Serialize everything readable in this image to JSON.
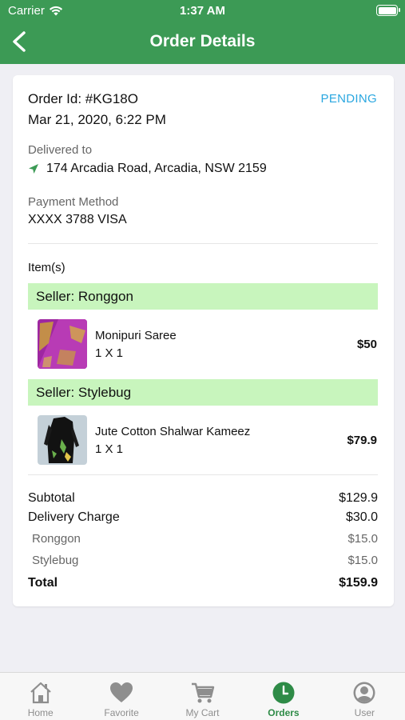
{
  "status_bar": {
    "carrier": "Carrier",
    "time": "1:37 AM"
  },
  "header": {
    "title": "Order Details"
  },
  "order": {
    "id_label": "Order Id: #KG18O",
    "date": "Mar 21, 2020, 6:22 PM",
    "status": "PENDING",
    "delivered_to_label": "Delivered to",
    "address": "174 Arcadia Road, Arcadia, NSW 2159",
    "payment_label": "Payment Method",
    "payment_value": "XXXX 3788 VISA",
    "items_label": "Item(s)"
  },
  "sellers": [
    {
      "label": "Seller: Ronggon",
      "item": {
        "name": "Monipuri Saree",
        "qty": "1 X 1",
        "price": "$50"
      }
    },
    {
      "label": "Seller: Stylebug",
      "item": {
        "name": "Jute Cotton Shalwar Kameez",
        "qty": "1 X 1",
        "price": "$79.9"
      }
    }
  ],
  "summary": {
    "subtotal_label": "Subtotal",
    "subtotal": "$129.9",
    "delivery_label": "Delivery Charge",
    "delivery": "$30.0",
    "ronggon_label": "Ronggon",
    "ronggon": "$15.0",
    "stylebug_label": "Stylebug",
    "stylebug": "$15.0",
    "total_label": "Total",
    "total": "$159.9"
  },
  "tabs": [
    {
      "label": "Home",
      "icon": "home-icon"
    },
    {
      "label": "Favorite",
      "icon": "heart-icon"
    },
    {
      "label": "My Cart",
      "icon": "cart-icon"
    },
    {
      "label": "Orders",
      "icon": "clock-icon",
      "active": true
    },
    {
      "label": "User",
      "icon": "user-icon"
    }
  ],
  "colors": {
    "header": "#3c9a55",
    "seller_band": "#c8f5bd",
    "status": "#2aa7e0",
    "active_tab": "#2e8b47"
  }
}
